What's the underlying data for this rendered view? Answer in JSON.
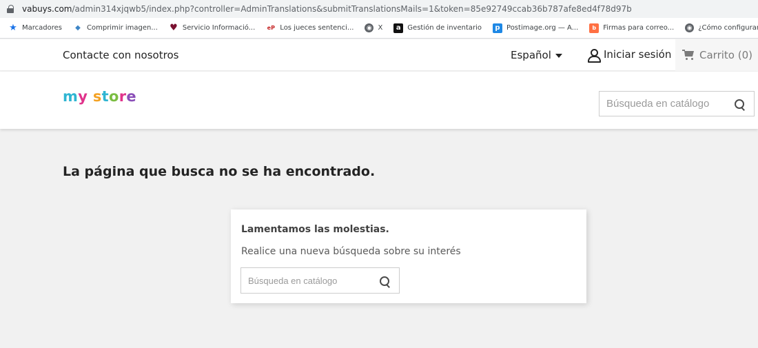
{
  "browser": {
    "url_host": "vabuys.com",
    "url_path": "/admin314xjqwb5/index.php?controller=AdminTranslations&submitTranslationsMails=1&token=85e92749ccab36b787afe8ed4f78d97b",
    "bookmarks": [
      {
        "label": "Marcadores",
        "icon": "star-icon",
        "glyph": "★"
      },
      {
        "label": "Comprimir imagen...",
        "icon": "fish-icon",
        "glyph": "◆"
      },
      {
        "label": "Servicio Informació...",
        "icon": "heart-icon",
        "glyph": "♥"
      },
      {
        "label": "Los jueces sentenci...",
        "icon": "ep-icon",
        "glyph": "eP"
      },
      {
        "label": "X",
        "icon": "globe-icon",
        "glyph": "◉"
      },
      {
        "label": "Gestión de inventario",
        "icon": "amazon-icon",
        "glyph": "a"
      },
      {
        "label": "Postimage.org — A...",
        "icon": "postimage-icon",
        "glyph": "p"
      },
      {
        "label": "Firmas para correo...",
        "icon": "firmas-icon",
        "glyph": "b"
      },
      {
        "label": "¿Cómo configurar l",
        "icon": "globe-icon",
        "glyph": "◉"
      }
    ]
  },
  "nav": {
    "contact": "Contacte con nosotros",
    "language": "Español",
    "login": "Iniciar sesión",
    "cart": "Carrito (0)"
  },
  "header": {
    "logo": [
      "m",
      "y",
      " ",
      "s",
      "t",
      "o",
      "r",
      "e"
    ],
    "search_placeholder": "Búsqueda en catálogo"
  },
  "main": {
    "title": "La página que busca no se ha encontrado.",
    "card_heading": "Lamentamos las molestias.",
    "card_text": "Realice una nueva búsqueda sobre su interés",
    "search_placeholder": "Búsqueda en catálogo"
  }
}
